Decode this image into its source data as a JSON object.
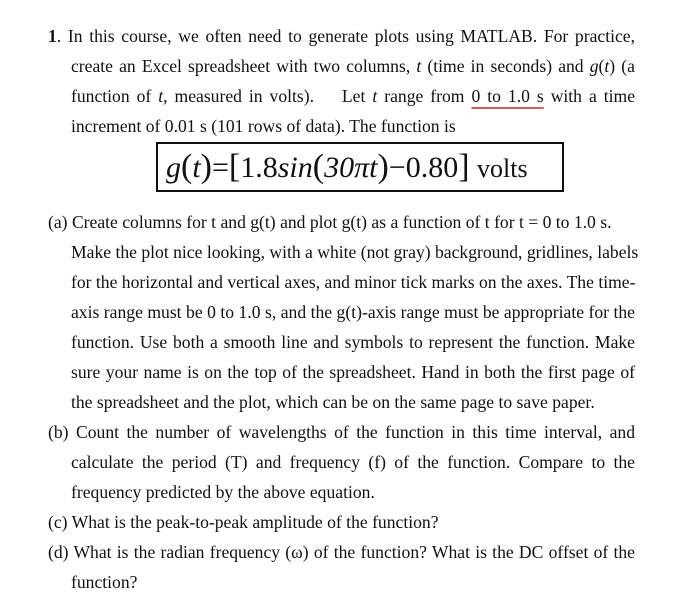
{
  "problem": {
    "number": "1",
    "intro": {
      "line1_rest": ". In this course, we often need to generate plots using MATLAB. For practice,",
      "line2_a": "create an Excel spreadsheet with two columns,",
      "line2_t": "t",
      "line2_b": "(time in seconds) and",
      "line2_g": "g",
      "line2_c": "(",
      "line2_t2": "t",
      "line2_d": ") (a",
      "line3_a": "function of",
      "line3_t": "t",
      "line3_b": ", measured in volts).    Let",
      "line3_t2": "t",
      "line3_c": "range from",
      "line3_range": "0 to 1.0 s",
      "line3_d": "with a time",
      "line4": "increment of 0.01 s (101 rows of data). The function is"
    },
    "equation": {
      "lhs_g": "g",
      "lhs_open": "(",
      "lhs_t": "t",
      "lhs_close": ")",
      "equals": "=",
      "bracket_open": "[",
      "amplitude": "1.8",
      "func": "sin",
      "paren_open": "(",
      "arg": "30πt",
      "paren_close": ")",
      "minus_offset": "−0.80",
      "bracket_close": "]",
      "unit": "volts"
    },
    "parts": [
      {
        "label": "(a)",
        "lines": [
          "Create columns for t and g(t) and plot g(t) as a function of t for t = 0 to 1.0 s.",
          "Make the plot nice looking, with a white (not gray) background, gridlines, labels",
          "for the horizontal and vertical axes, and minor tick marks on the axes. The time-",
          "axis range must be 0 to 1.0 s, and the g(t)-axis range must be appropriate for the",
          "function. Use both a smooth line and symbols to represent the function. Make",
          "sure your name is on the top of the spreadsheet. Hand in both the first page of",
          "the spreadsheet and the plot, which can be on the same page to save paper."
        ]
      },
      {
        "label": "(b)",
        "lines": [
          "Count the number of wavelengths of the function in this time interval, and",
          "calculate the period (T) and frequency (f) of the function. Compare to the",
          "frequency predicted by the above equation."
        ]
      },
      {
        "label": "(c)",
        "lines": [
          "What is the peak-to-peak amplitude of the function?"
        ]
      },
      {
        "label": "(d)",
        "lines": [
          "What is the radian frequency (ω) of the function? What is the DC offset of the",
          "function?"
        ]
      }
    ]
  },
  "colors": {
    "text": "#111111",
    "underline": "#d0605a",
    "background": "#ffffff"
  }
}
